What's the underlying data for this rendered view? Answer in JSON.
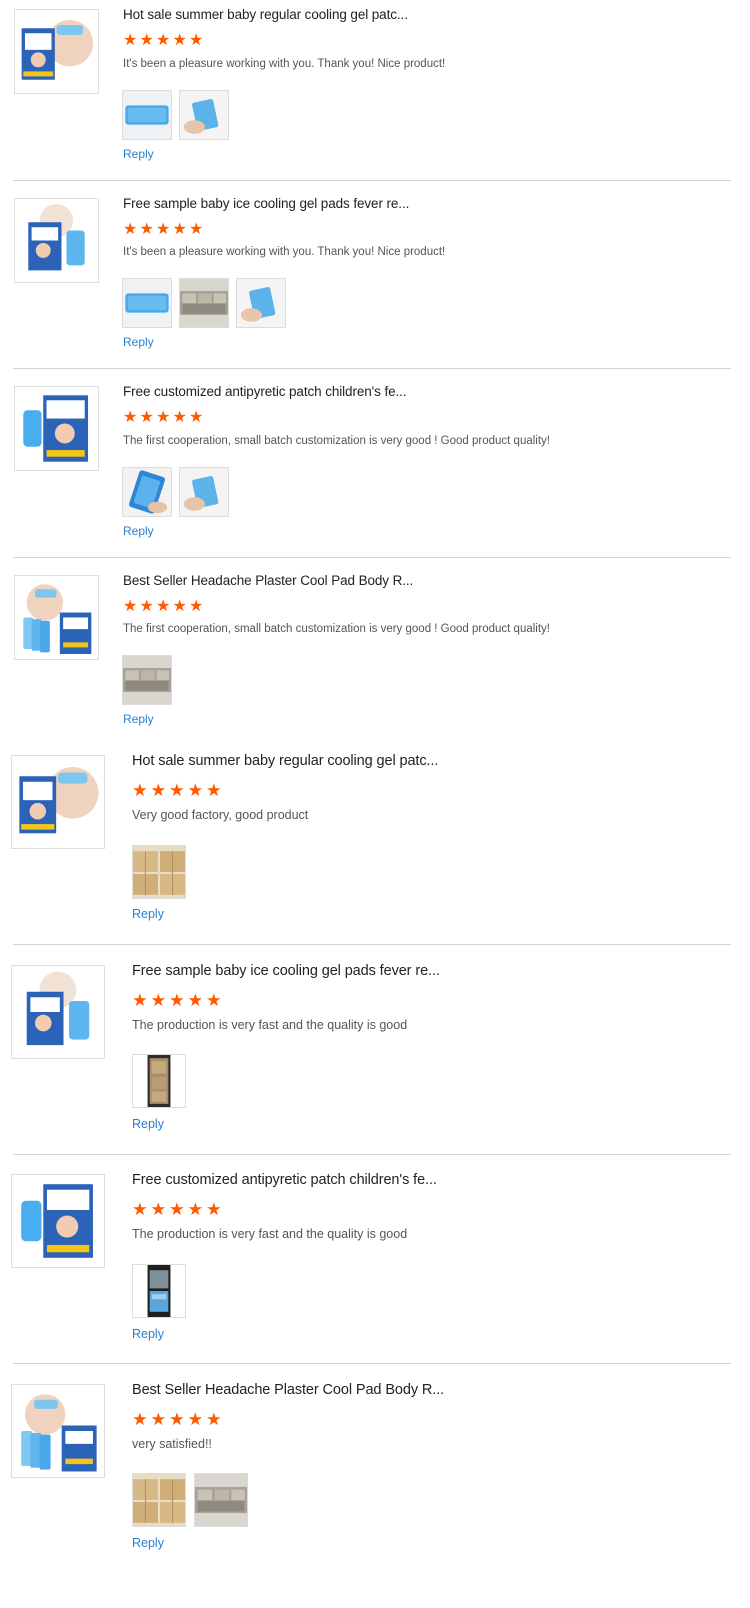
{
  "colors": {
    "star": "#ff5a00",
    "reply_link": "#2a7fd0",
    "divider": "#d4d4d4"
  },
  "reply_label": "Reply",
  "star_glyph": "★",
  "reviews": [
    {
      "product_title": "Hot sale summer baby regular cooling gel patc...",
      "rating": 5,
      "comment": "It's been a pleasure working with you. Thank you!  Nice product!",
      "thumbnail": "baby-forehead-gel-box",
      "photos": [
        "blue-gel-sheet",
        "hand-holding-gel"
      ]
    },
    {
      "product_title": "Free sample baby ice cooling gel pads fever re...",
      "rating": 5,
      "comment": "It's been a pleasure working with you. Thank you!  Nice product!",
      "thumbnail": "gel-box-with-sheet",
      "photos": [
        "blue-gel-sheet",
        "cartons-warehouse",
        "hand-holding-gel"
      ]
    },
    {
      "product_title": "Free customized antipyretic patch children's fe...",
      "rating": 5,
      "comment": "The first cooperation, small batch customization is very good !  Good product quality!",
      "thumbnail": "gel-box-blue-sheet",
      "photos": [
        "blue-gel-pack",
        "hand-holding-gel"
      ]
    },
    {
      "product_title": "Best Seller Headache Plaster Cool Pad Body R...",
      "rating": 5,
      "comment": "The first cooperation, small batch customization is very good !  Good product quality!",
      "thumbnail": "baby-with-gel-sheets-box",
      "photos": [
        "cartons-warehouse"
      ]
    },
    {
      "product_title": "Hot sale summer baby regular cooling gel patc...",
      "rating": 5,
      "comment": "Very good factory, good product",
      "thumbnail": "baby-forehead-gel-box",
      "photos": [
        "cartons-stacked"
      ]
    },
    {
      "product_title": "Free sample baby ice cooling gel pads fever re...",
      "rating": 5,
      "comment": "The production is very fast and the quality is good",
      "thumbnail": "gel-box-with-sheet",
      "photos": [
        "warehouse-aisle"
      ]
    },
    {
      "product_title": "Free customized antipyretic patch children's fe...",
      "rating": 5,
      "comment": "The production is very fast and the quality is good",
      "thumbnail": "gel-box-blue-sheet",
      "photos": [
        "packing-line"
      ]
    },
    {
      "product_title": "Best Seller Headache Plaster Cool Pad Body R...",
      "rating": 5,
      "comment": "very satisfied!!",
      "thumbnail": "baby-with-gel-sheets-box",
      "photos": [
        "cartons-stacked",
        "cartons-warehouse"
      ]
    }
  ]
}
